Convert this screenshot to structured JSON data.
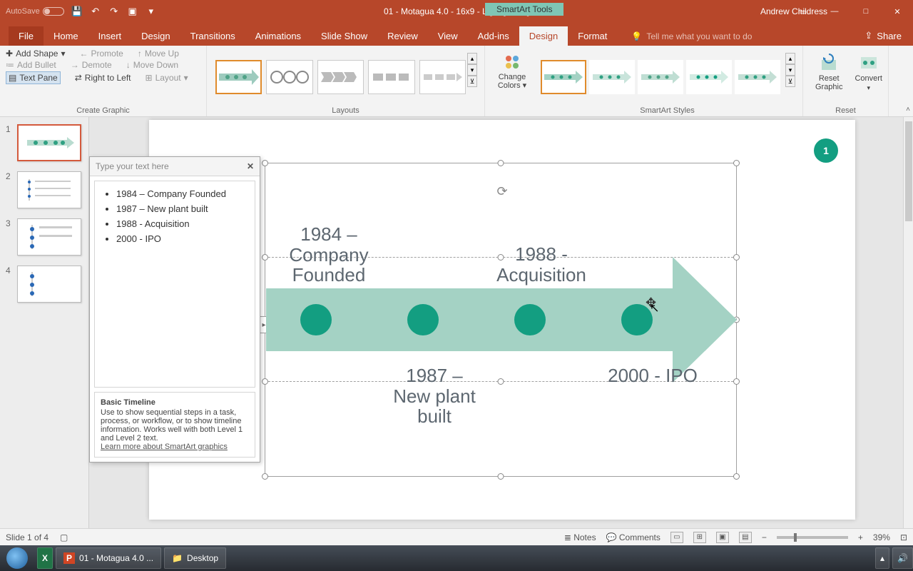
{
  "titlebar": {
    "autosave_label": "AutoSave",
    "doc_title": "01 - Motagua 4.0 - 16x9 - Light [MAIN]",
    "tools_label": "SmartArt Tools",
    "user": "Andrew Childress"
  },
  "tabs": {
    "file": "File",
    "home": "Home",
    "insert": "Insert",
    "design": "Design",
    "transitions": "Transitions",
    "animations": "Animations",
    "slideshow": "Slide Show",
    "review": "Review",
    "view": "View",
    "addins": "Add-ins",
    "sa_design": "Design",
    "format": "Format",
    "tellme": "Tell me what you want to do",
    "share": "Share"
  },
  "ribbon": {
    "create": {
      "add_shape": "Add Shape",
      "add_bullet": "Add Bullet",
      "text_pane": "Text Pane",
      "promote": "Promote",
      "demote": "Demote",
      "rtl": "Right to Left",
      "move_up": "Move Up",
      "move_down": "Move Down",
      "layout": "Layout",
      "label": "Create Graphic"
    },
    "layouts_label": "Layouts",
    "change_colors": "Change Colors",
    "styles_label": "SmartArt Styles",
    "reset": {
      "reset": "Reset Graphic",
      "convert": "Convert",
      "label": "Reset"
    }
  },
  "thumbs": [
    "1",
    "2",
    "3",
    "4"
  ],
  "text_pane": {
    "header": "Type your text here",
    "items": [
      "1984  – Company Founded",
      "1987 – New plant built",
      "1988  - Acquisition",
      "2000  - IPO"
    ],
    "footer_title": "Basic Timeline",
    "footer_body": "Use to show sequential steps in a task, process, or workflow, or to show timeline information. Works well with both Level 1 and Level 2 text.",
    "footer_link": "Learn more about SmartArt graphics"
  },
  "slide": {
    "badge": "1",
    "labels": {
      "l1a": "1984 –",
      "l1b": "Company",
      "l1c": "Founded",
      "l2a": "1987 –",
      "l2b": "New plant",
      "l2c": "built",
      "l3a": "1988 -",
      "l3b": "Acquisition",
      "l4": "2000 - IPO"
    }
  },
  "status": {
    "slide": "Slide 1 of 4",
    "notes": "Notes",
    "comments": "Comments",
    "zoom": "39%"
  },
  "taskbar": {
    "ppt": "01 - Motagua 4.0 ...",
    "desktop": "Desktop"
  }
}
